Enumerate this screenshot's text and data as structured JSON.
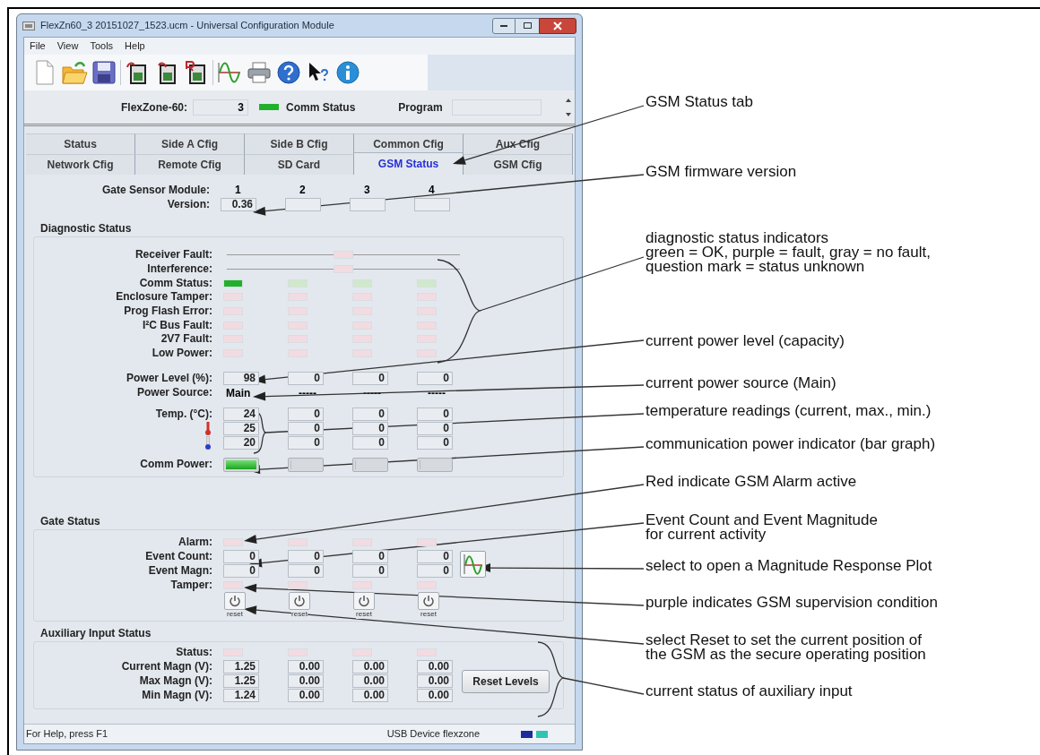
{
  "window": {
    "title": "FlexZn60_3 20151027_1523.ucm - Universal Configuration Module",
    "menu": [
      "File",
      "View",
      "Tools",
      "Help"
    ]
  },
  "header": {
    "device_label": "FlexZone-60:",
    "device_value": "3",
    "comm_ok": true,
    "comm_label": "Comm Status",
    "program_label": "Program"
  },
  "tab_rows": [
    [
      {
        "label": "Status",
        "selected": false
      },
      {
        "label": "Side A Cfig",
        "selected": false
      },
      {
        "label": "Side B Cfig",
        "selected": false
      },
      {
        "label": "Common Cfig",
        "selected": false
      },
      {
        "label": "Aux Cfig",
        "selected": false
      }
    ],
    [
      {
        "label": "Network Cfig",
        "selected": false
      },
      {
        "label": "Remote Cfig",
        "selected": false
      },
      {
        "label": "SD Card",
        "selected": false
      },
      {
        "label": "GSM Status",
        "selected": true
      },
      {
        "label": "GSM Cfig",
        "selected": false
      }
    ]
  ],
  "modules": {
    "label": "Gate Sensor Module:",
    "columns": [
      "1",
      "2",
      "3",
      "4"
    ]
  },
  "version": {
    "label": "Version:",
    "values": [
      "0.36"
    ]
  },
  "diagnostic": {
    "title": "Diagnostic Status",
    "rows": [
      {
        "label": "Receiver Fault:",
        "kind": "shared",
        "lit": false
      },
      {
        "label": "Interference:",
        "kind": "shared",
        "lit": false
      },
      {
        "label": "Comm Status:",
        "kind": "ok",
        "lit": [
          true,
          false,
          false,
          false
        ]
      },
      {
        "label": "Enclosure Tamper:",
        "kind": "fault",
        "lit": [
          false,
          false,
          false,
          false
        ]
      },
      {
        "label": "Prog Flash Error:",
        "kind": "fault",
        "lit": [
          false,
          false,
          false,
          false
        ]
      },
      {
        "label": "I²C Bus Fault:",
        "kind": "fault",
        "lit": [
          false,
          false,
          false,
          false
        ]
      },
      {
        "label": "2V7 Fault:",
        "kind": "fault",
        "lit": [
          false,
          false,
          false,
          false
        ]
      },
      {
        "label": "Low Power:",
        "kind": "fault",
        "lit": [
          false,
          false,
          false,
          false
        ]
      }
    ],
    "power_level": {
      "label": "Power Level (%):",
      "values": [
        "98",
        "0",
        "0",
        "0"
      ]
    },
    "power_source": {
      "label": "Power Source:",
      "values": [
        "Main",
        "-----",
        "-----",
        "-----"
      ]
    },
    "temperature": {
      "label": "Temp. (°C):",
      "rows": [
        [
          "24",
          "0",
          "0",
          "0"
        ],
        [
          "25",
          "0",
          "0",
          "0"
        ],
        [
          "20",
          "0",
          "0",
          "0"
        ]
      ]
    },
    "comm_power": {
      "label": "Comm Power:",
      "bars": [
        {
          "level": 1
        },
        {
          "level": 0
        },
        {
          "level": 0
        },
        {
          "level": 0
        }
      ]
    }
  },
  "gate_status": {
    "title": "Gate Status",
    "alarm": {
      "label": "Alarm:",
      "lit": [
        false,
        false,
        false,
        false
      ]
    },
    "event_count": {
      "label": "Event Count:",
      "values": [
        "0",
        "0",
        "0",
        "0"
      ]
    },
    "event_magn": {
      "label": "Event Magn:",
      "values": [
        "0",
        "0",
        "0",
        "0"
      ]
    },
    "tamper": {
      "label": "Tamper:",
      "lit": [
        false,
        false,
        false,
        false
      ]
    },
    "reset_labels": [
      "reset",
      "reset",
      "reset",
      "reset"
    ]
  },
  "aux_status": {
    "title": "Auxiliary Input Status",
    "status": {
      "label": "Status:",
      "lit": [
        false,
        false,
        false,
        false
      ]
    },
    "rows": [
      {
        "label": "Current Magn (V):",
        "values": [
          "1.25",
          "0.00",
          "0.00",
          "0.00"
        ]
      },
      {
        "label": "Max Magn (V):",
        "values": [
          "1.25",
          "0.00",
          "0.00",
          "0.00"
        ]
      },
      {
        "label": "Min Magn (V):",
        "values": [
          "1.24",
          "0.00",
          "0.00",
          "0.00"
        ]
      }
    ],
    "button": "Reset Levels"
  },
  "status_bar": {
    "help": "For Help, press F1",
    "device": "USB Device flexzone"
  },
  "annotations": [
    {
      "lines": [
        "GSM Status tab"
      ]
    },
    {
      "lines": [
        "GSM firmware version"
      ]
    },
    {
      "lines": [
        "diagnostic status indicators",
        "green = OK, purple = fault, gray = no fault,",
        "question mark = status unknown"
      ]
    },
    {
      "lines": [
        "current power level (capacity)"
      ]
    },
    {
      "lines": [
        "current power source (Main)"
      ]
    },
    {
      "lines": [
        "temperature readings (current, max., min.)"
      ]
    },
    {
      "lines": [
        "communication power indicator (bar graph)"
      ]
    },
    {
      "lines": [
        "Red indicate GSM Alarm active"
      ]
    },
    {
      "lines": [
        "Event Count and Event Magnitude",
        "for current activity"
      ]
    },
    {
      "lines": [
        "select to open a Magnitude Response Plot"
      ]
    },
    {
      "lines": [
        "purple indicates GSM supervision condition"
      ]
    },
    {
      "lines": [
        "select Reset to set the current position of",
        "the GSM as the secure operating position"
      ]
    },
    {
      "lines": [
        "current status of auxiliary input"
      ]
    }
  ]
}
